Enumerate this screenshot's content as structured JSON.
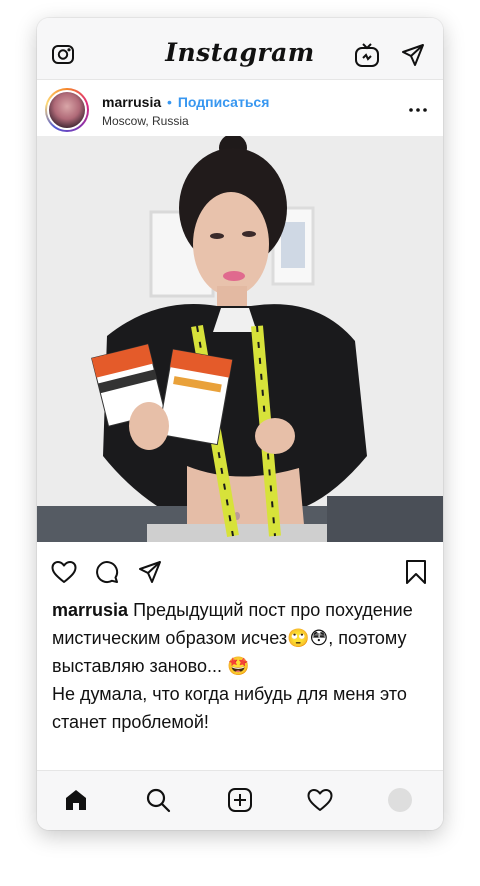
{
  "app": {
    "logo": "Instagram"
  },
  "topbar": {
    "camera_icon": "camera-icon",
    "igtv_icon": "igtv-icon",
    "direct_icon": "paper-plane-icon"
  },
  "post": {
    "username": "marrusia",
    "separator": "•",
    "follow_label": "Подписаться",
    "location": "Moscow, Russia",
    "more_icon": "more-dots-icon"
  },
  "actions": {
    "like_icon": "heart-icon",
    "comment_icon": "comment-icon",
    "share_icon": "paper-plane-icon",
    "save_icon": "bookmark-icon"
  },
  "caption": {
    "username": "marrusia",
    "text_line1": "Предыдущий пост про похудение мистическим образом исчез🙄😳, поэтому выставляю заново... 🤩",
    "text_line2": "Не думала, что когда нибудь для меня это станет проблемой!"
  },
  "bottom_nav": {
    "items": [
      "home-icon",
      "search-icon",
      "add-post-icon",
      "heart-icon",
      "profile-avatar"
    ]
  },
  "colors": {
    "accent": "#3897f0",
    "text": "#111111",
    "bar_bg": "#f7f7f8"
  }
}
